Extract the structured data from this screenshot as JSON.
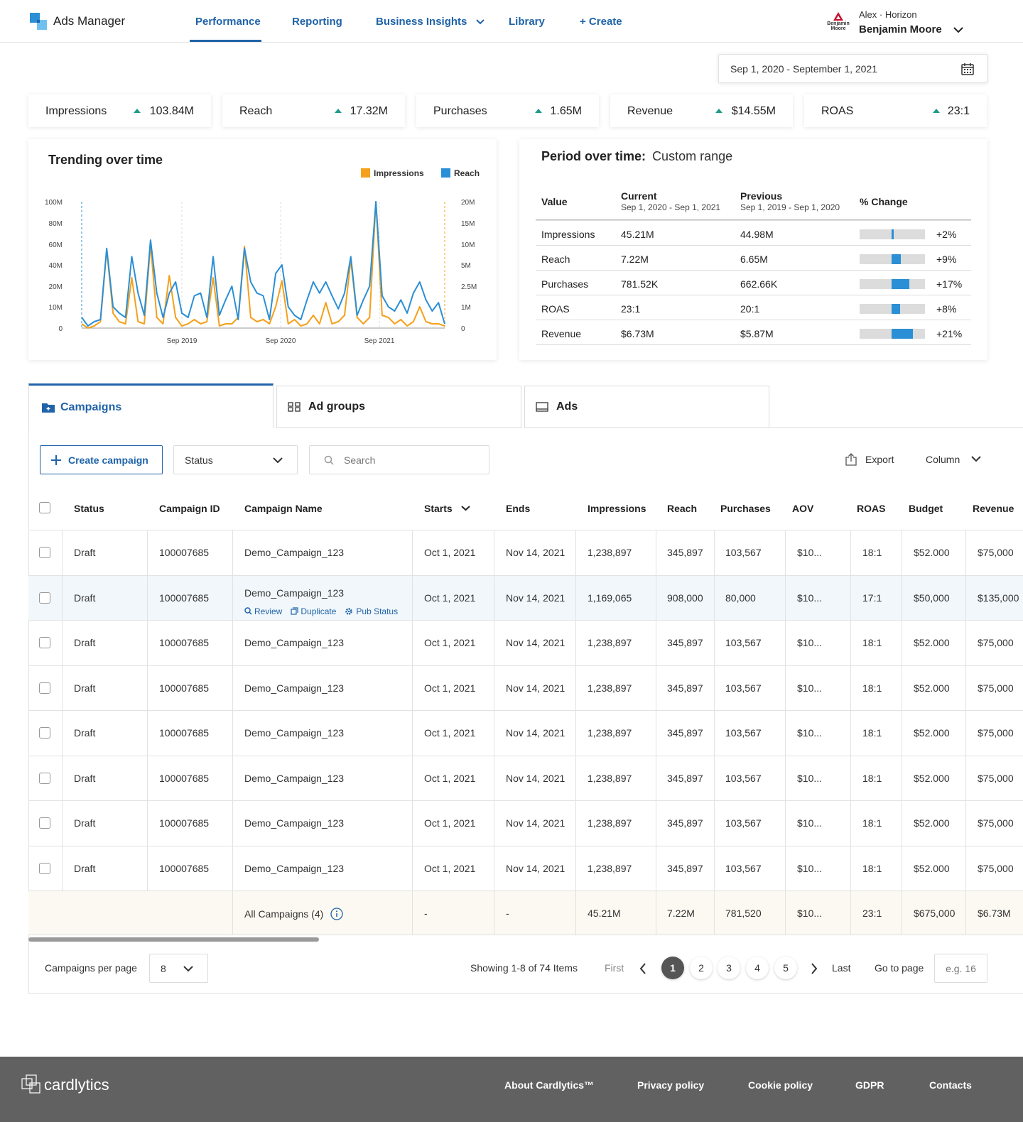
{
  "header": {
    "app_title": "Ads Manager",
    "nav": [
      "Performance",
      "Reporting",
      "Business Insights",
      "Library",
      "+ Create"
    ],
    "active_nav": "Performance",
    "account_org": "Alex · Horizon",
    "account_name": "Benjamin Moore",
    "account_logo_text_1": "Benjamin",
    "account_logo_text_2": "Moore"
  },
  "date_range": "Sep 1, 2020 - September 1, 2021",
  "kpis": [
    {
      "label": "Impressions",
      "value": "103.84M"
    },
    {
      "label": "Reach",
      "value": "17.32M"
    },
    {
      "label": "Purchases",
      "value": "1.65M"
    },
    {
      "label": "Revenue",
      "value": "$14.55M"
    },
    {
      "label": "ROAS",
      "value": "23:1"
    }
  ],
  "trending": {
    "title": "Trending over time",
    "legend": [
      "Impressions",
      "Reach"
    ]
  },
  "chart_data": {
    "type": "line",
    "title": "Trending over time",
    "x_ticks": [
      "Sep 2019",
      "Sep 2020",
      "Sep 2021"
    ],
    "y_left_ticks": [
      "100M",
      "80M",
      "60M",
      "40M",
      "20M",
      "10M",
      "0"
    ],
    "y_right_ticks": [
      "20M",
      "15M",
      "10M",
      "5M",
      "2.5M",
      "1M",
      "0"
    ],
    "legend_position": "top-right",
    "colors": {
      "Impressions": "#f5a01a",
      "Reach": "#2b8fd6"
    },
    "series": [
      {
        "name": "Impressions",
        "axis": "left",
        "values": [
          2,
          0,
          1,
          3,
          55,
          7,
          3,
          2,
          28,
          3,
          2,
          60,
          5,
          2,
          30,
          5,
          1,
          2,
          4,
          2,
          3,
          28,
          1,
          2,
          2,
          5,
          58,
          5,
          3,
          4,
          2,
          10,
          25,
          2,
          4,
          1,
          2,
          6,
          2,
          12,
          2,
          3,
          6,
          45,
          5,
          2,
          5,
          100,
          6,
          5,
          2,
          4,
          1,
          3,
          10,
          3,
          2,
          2,
          1
        ]
      },
      {
        "name": "Reach",
        "axis": "right",
        "values": [
          0.5,
          0.1,
          0.3,
          0.4,
          9,
          1,
          0.7,
          0.5,
          7,
          2,
          0.6,
          11,
          2,
          0.5,
          2,
          3,
          0.7,
          0.5,
          1.8,
          2,
          0.5,
          7,
          0.6,
          1.5,
          2.5,
          0.4,
          9,
          3,
          2,
          1.8,
          0.4,
          4,
          5,
          1,
          0.6,
          0.4,
          1.5,
          3,
          2,
          3,
          1.8,
          0.9,
          2,
          7,
          0.6,
          1.5,
          2.5,
          20,
          1.8,
          1,
          0.8,
          1.5,
          0.7,
          2,
          3,
          1.5,
          0.8,
          1.3,
          0.2
        ]
      }
    ]
  },
  "period": {
    "title": "Period over time:",
    "range_label": "Custom range",
    "headers": {
      "value": "Value",
      "current": "Current",
      "current_range": "Sep 1, 2020 - Sep 1, 2021",
      "previous": "Previous",
      "previous_range": "Sep 1, 2019 - Sep 1, 2020",
      "change": "% Change"
    },
    "rows": [
      {
        "name": "Impressions",
        "current": "45.21M",
        "previous": "44.98M",
        "change": "+2%",
        "pct": 2
      },
      {
        "name": "Reach",
        "current": "7.22M",
        "previous": "6.65M",
        "change": "+9%",
        "pct": 9
      },
      {
        "name": "Purchases",
        "current": "781.52K",
        "previous": "662.66K",
        "change": "+17%",
        "pct": 17
      },
      {
        "name": "ROAS",
        "current": "23:1",
        "previous": "20:1",
        "change": "+8%",
        "pct": 8
      },
      {
        "name": "Revenue",
        "current": "$6.73M",
        "previous": "$5.87M",
        "change": "+21%",
        "pct": 21
      }
    ]
  },
  "tabs": [
    "Campaigns",
    "Ad groups",
    "Ads"
  ],
  "toolbar": {
    "create": "Create campaign",
    "status": "Status",
    "search_placeholder": "Search",
    "export": "Export",
    "column": "Column"
  },
  "table": {
    "columns": [
      "Status",
      "Campaign ID",
      "Campaign Name",
      "Starts",
      "Ends",
      "Impressions",
      "Reach",
      "Purchases",
      "AOV",
      "ROAS",
      "Budget",
      "Revenue"
    ],
    "rows": [
      [
        "Draft",
        "100007685",
        "Demo_Campaign_123",
        "Oct 1, 2021",
        "Nov 14, 2021",
        "1,238,897",
        "345,897",
        "103,567",
        "$10...",
        "18:1",
        "$52.000",
        "$75,000"
      ],
      [
        "Draft",
        "100007685",
        "Demo_Campaign_123",
        "Oct 1, 2021",
        "Nov 14, 2021",
        "1,169,065",
        "908,000",
        "80,000",
        "$10...",
        "17:1",
        "$50,000",
        "$135,000"
      ],
      [
        "Draft",
        "100007685",
        "Demo_Campaign_123",
        "Oct 1, 2021",
        "Nov 14, 2021",
        "1,238,897",
        "345,897",
        "103,567",
        "$10...",
        "18:1",
        "$52.000",
        "$75,000"
      ],
      [
        "Draft",
        "100007685",
        "Demo_Campaign_123",
        "Oct 1, 2021",
        "Nov 14, 2021",
        "1,238,897",
        "345,897",
        "103,567",
        "$10...",
        "18:1",
        "$52.000",
        "$75,000"
      ],
      [
        "Draft",
        "100007685",
        "Demo_Campaign_123",
        "Oct 1, 2021",
        "Nov 14, 2021",
        "1,238,897",
        "345,897",
        "103,567",
        "$10...",
        "18:1",
        "$52.000",
        "$75,000"
      ],
      [
        "Draft",
        "100007685",
        "Demo_Campaign_123",
        "Oct 1, 2021",
        "Nov 14, 2021",
        "1,238,897",
        "345,897",
        "103,567",
        "$10...",
        "18:1",
        "$52.000",
        "$75,000"
      ],
      [
        "Draft",
        "100007685",
        "Demo_Campaign_123",
        "Oct 1, 2021",
        "Nov 14, 2021",
        "1,238,897",
        "345,897",
        "103,567",
        "$10...",
        "18:1",
        "$52.000",
        "$75,000"
      ],
      [
        "Draft",
        "100007685",
        "Demo_Campaign_123",
        "Oct 1, 2021",
        "Nov 14, 2021",
        "1,238,897",
        "345,897",
        "103,567",
        "$10...",
        "18:1",
        "$52.000",
        "$75,000"
      ]
    ],
    "row_actions": [
      "Review",
      "Duplicate",
      "Pub Status"
    ],
    "totals": [
      "All Campaigns (4)",
      "-",
      "-",
      "45.21M",
      "7.22M",
      "781,520",
      "$10...",
      "23:1",
      "$675,000",
      "$6.73M"
    ]
  },
  "pagination": {
    "per_page_label": "Campaigns per page",
    "per_page_value": "8",
    "showing": "Showing 1-8 of 74 Items",
    "first": "First",
    "last": "Last",
    "pages": [
      "1",
      "2",
      "3",
      "4",
      "5"
    ],
    "goto_label": "Go to page",
    "goto_placeholder": "e.g. 16"
  },
  "footer": {
    "brand": "cardlytics",
    "links": [
      "About Cardlytics™",
      "Privacy policy",
      "Cookie policy",
      "GDPR",
      "Contacts"
    ]
  }
}
